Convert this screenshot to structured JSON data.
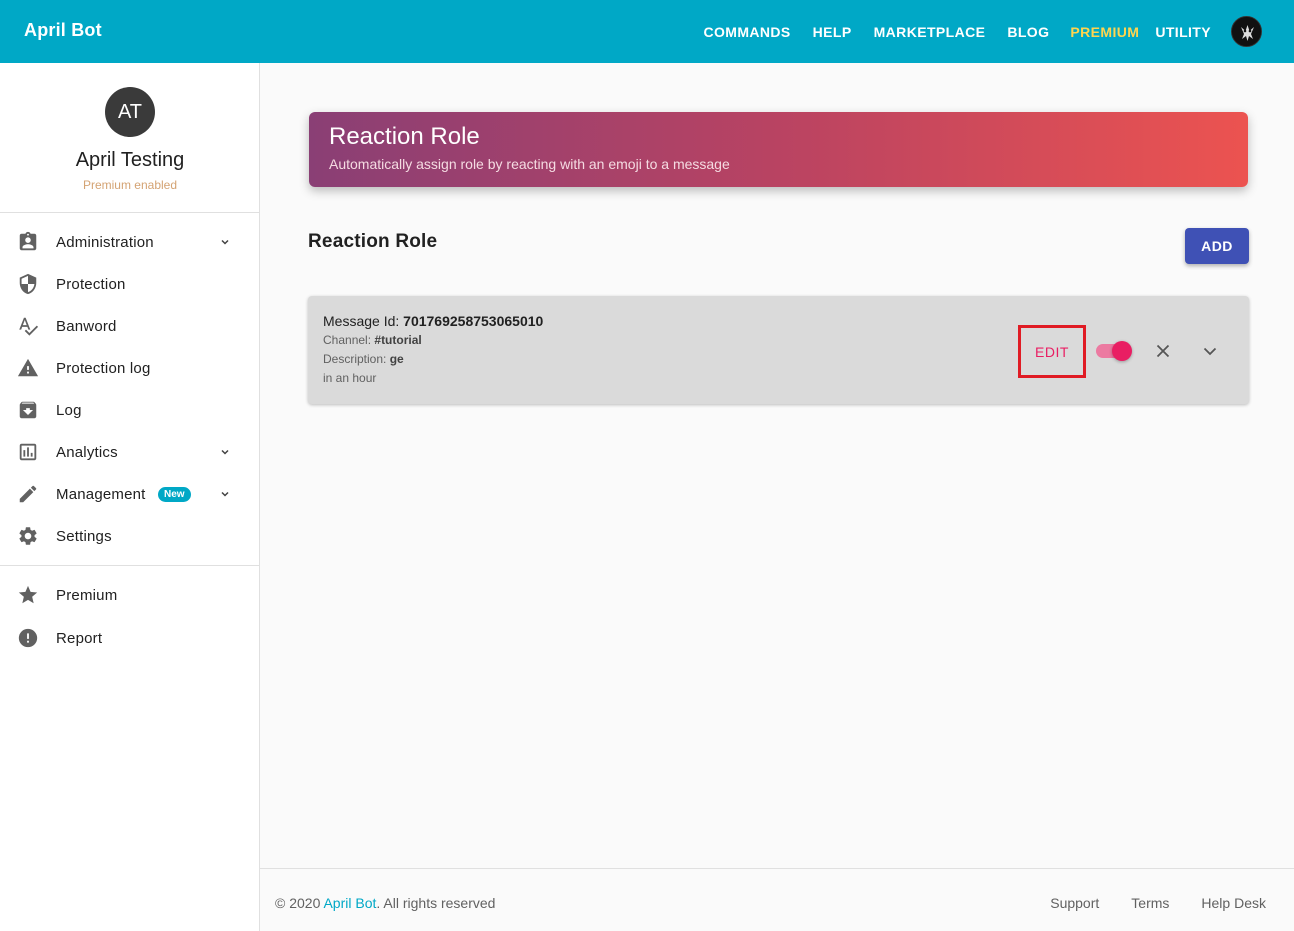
{
  "topbar": {
    "brand": "April Bot",
    "nav": [
      {
        "label": "COMMANDS"
      },
      {
        "label": "HELP"
      },
      {
        "label": "MARKETPLACE"
      },
      {
        "label": "BLOG"
      },
      {
        "label": "PREMIUM"
      },
      {
        "label": "UTILITY"
      }
    ],
    "accent_color": "#00a8c6",
    "premium_color": "#ffd54f"
  },
  "profile": {
    "initials": "AT",
    "name": "April Testing",
    "status": "Premium enabled"
  },
  "sidebar": {
    "items": [
      {
        "label": "Administration",
        "icon": "clipboard-account-icon",
        "expandable": true
      },
      {
        "label": "Protection",
        "icon": "shield-icon"
      },
      {
        "label": "Banword",
        "icon": "spellcheck-icon"
      },
      {
        "label": "Protection log",
        "icon": "warning-icon"
      },
      {
        "label": "Log",
        "icon": "archive-icon"
      },
      {
        "label": "Analytics",
        "icon": "bar-chart-icon",
        "expandable": true
      },
      {
        "label": "Management",
        "icon": "pencil-icon",
        "expandable": true,
        "badge": "New"
      },
      {
        "label": "Settings",
        "icon": "gear-icon"
      }
    ],
    "secondary_items": [
      {
        "label": "Premium",
        "icon": "star-icon"
      },
      {
        "label": "Report",
        "icon": "alert-circle-icon"
      }
    ]
  },
  "hero": {
    "title": "Reaction Role",
    "subtitle": "Automatically assign role by reacting with an emoji to a message"
  },
  "section": {
    "title": "Reaction Role",
    "add_label": "ADD"
  },
  "card": {
    "message_id_label": "Message Id:",
    "message_id": "701769258753065010",
    "channel_label": "Channel:",
    "channel": "#tutorial",
    "description_label": "Description:",
    "description": "ge",
    "time": "in an hour",
    "edit_label": "EDIT",
    "enabled": true
  },
  "footer": {
    "copyright_prefix": "© 2020 ",
    "copyright_link": "April Bot",
    "copyright_suffix": ". All rights reserved",
    "links": [
      {
        "label": "Support"
      },
      {
        "label": "Terms"
      },
      {
        "label": "Help Desk"
      }
    ]
  }
}
